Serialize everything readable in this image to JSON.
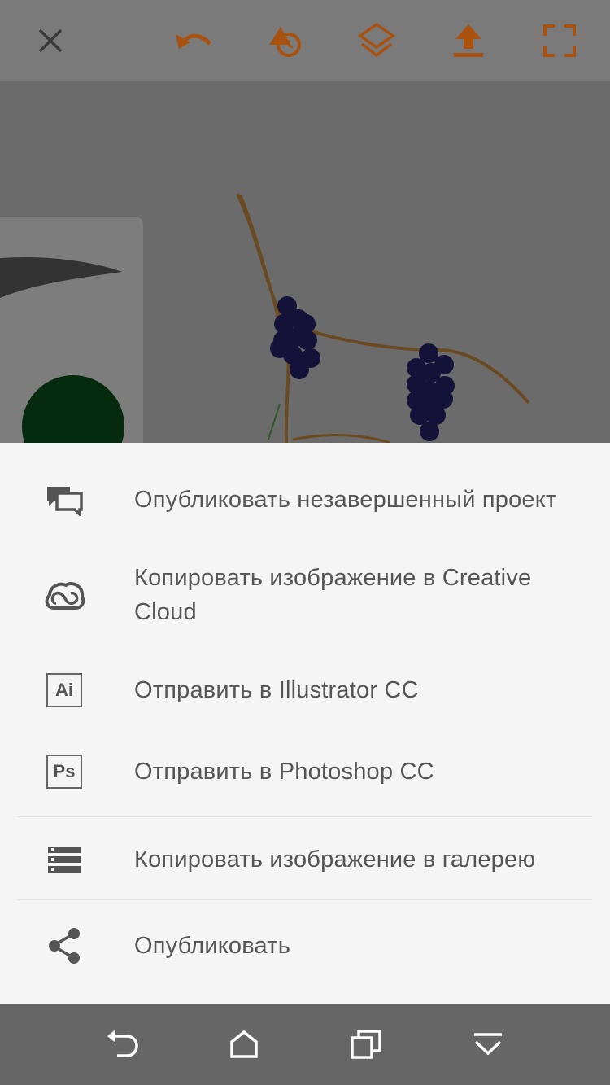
{
  "toolbar": {
    "icons": [
      "close-icon",
      "undo-icon",
      "shapes-icon",
      "layers-icon",
      "upload-icon",
      "fullscreen-icon"
    ],
    "accent_color": "#b35a12"
  },
  "menu": {
    "items": [
      {
        "label": "Опубликовать незавершенный проект",
        "icon": "chat-bubbles-icon"
      },
      {
        "label": "Копировать изображение в Creative Cloud",
        "icon": "creative-cloud-icon"
      },
      {
        "label": "Отправить в Illustrator CC",
        "icon": "illustrator-icon",
        "badge": "Ai"
      },
      {
        "label": "Отправить в Photoshop CC",
        "icon": "photoshop-icon",
        "badge": "Ps"
      },
      {
        "label": "Копировать изображение в галерею",
        "icon": "gallery-icon"
      },
      {
        "label": "Опубликовать",
        "icon": "share-icon"
      }
    ]
  },
  "navbar": {
    "icons": [
      "back-icon",
      "home-icon",
      "recents-icon",
      "hide-keyboard-icon"
    ]
  }
}
